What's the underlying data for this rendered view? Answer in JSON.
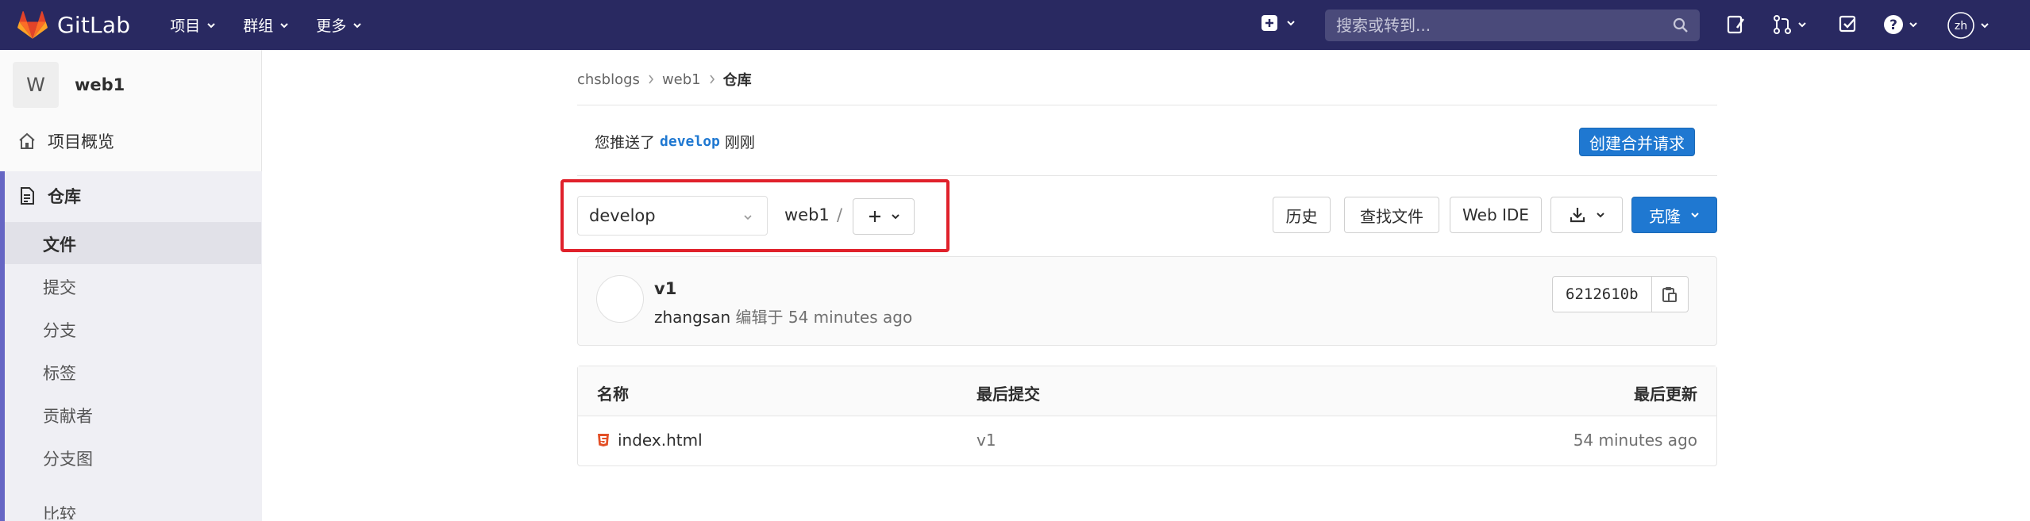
{
  "navbar": {
    "brand": "GitLab",
    "menu": [
      {
        "label": "项目"
      },
      {
        "label": "群组"
      },
      {
        "label": "更多"
      }
    ],
    "search_placeholder": "搜索或转到..."
  },
  "sidebar": {
    "project_avatar": "W",
    "project_name": "web1",
    "overview_label": "项目概览",
    "repository_label": "仓库",
    "sub_items": [
      "文件",
      "提交",
      "分支",
      "标签",
      "贡献者",
      "分支图",
      "比较"
    ]
  },
  "breadcrumb": {
    "group": "chsblogs",
    "project": "web1",
    "current": "仓库"
  },
  "push_notice": {
    "prefix": "您推送了",
    "branch": "develop",
    "suffix": "刚刚",
    "button": "创建合并请求"
  },
  "toolbar": {
    "branch": "develop",
    "path_root": "web1",
    "path_sep": "/",
    "history": "历史",
    "find_file": "查找文件",
    "web_ide": "Web IDE",
    "clone": "克隆"
  },
  "last_commit": {
    "title": "v1",
    "author": "zhangsan",
    "action": "编辑于",
    "time": "54 minutes ago",
    "sha": "6212610b"
  },
  "file_table": {
    "headers": {
      "name": "名称",
      "last_commit": "最后提交",
      "last_update": "最后更新"
    },
    "rows": [
      {
        "name": "index.html",
        "commit": "v1",
        "updated": "54 minutes ago"
      }
    ]
  },
  "colors": {
    "navbar": "#292961",
    "primary_button": "#1f78d1",
    "highlight_border": "#e0212b",
    "sidebar_accent": "#6666c4"
  }
}
